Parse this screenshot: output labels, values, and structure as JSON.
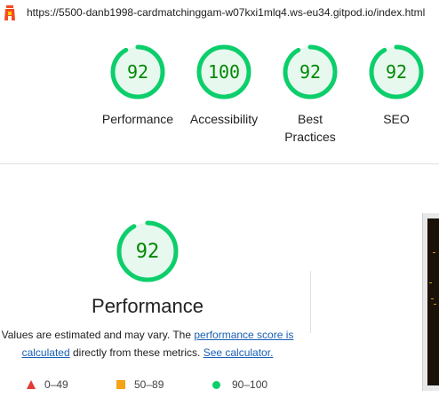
{
  "header": {
    "url": "https://5500-danb1998-cardmatchinggam-w07kxi1mlq4.ws-eu34.gitpod.io/index.html"
  },
  "summary_scores": [
    {
      "score": "92",
      "label": "Performance",
      "value": 0.92
    },
    {
      "score": "100",
      "label": "Accessibility",
      "value": 1.0
    },
    {
      "score": "92",
      "label": "Best Practices",
      "value": 0.92
    },
    {
      "score": "92",
      "label": "SEO",
      "value": 0.92
    }
  ],
  "performance": {
    "score": "92",
    "value": 0.92,
    "title": "Performance",
    "desc_prefix": "Values are estimated and may vary. The ",
    "desc_link1": "performance score is calculated",
    "desc_middle": " directly from these metrics. ",
    "desc_link2": "See calculator."
  },
  "legend": {
    "fail": "0–49",
    "average": "50–89",
    "pass": "90–100"
  },
  "colors": {
    "pass": "#0cce6b",
    "pass_text": "#008800",
    "pass_bg": "#e7f8ef",
    "average": "#f6a316",
    "fail": "#e53935",
    "link": "#1a5fb4"
  }
}
